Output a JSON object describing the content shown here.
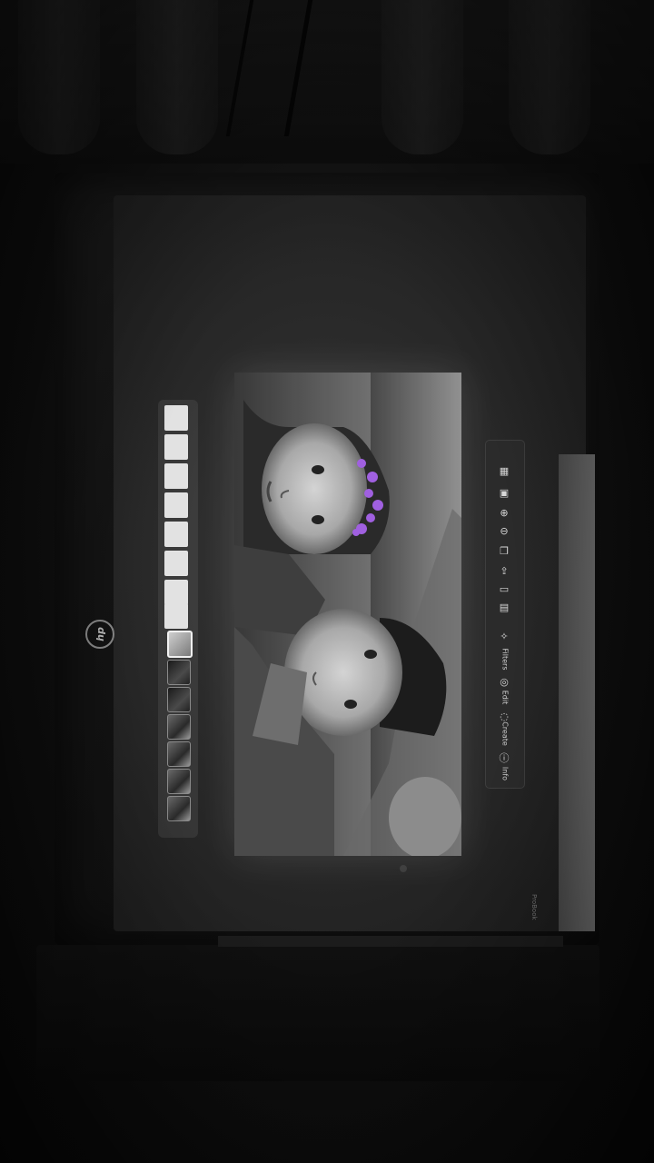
{
  "scene": {
    "subject": "laptop-screen-photo",
    "colors": {
      "tint": "#a060e0",
      "background": "#0b0b0b"
    }
  },
  "laptop": {
    "logo_text": "hp",
    "brand_text": "ProBook"
  },
  "filmstrip": {
    "empty_frames": 8,
    "thumbnails": [
      {
        "name": "thumb-1",
        "selected": true
      },
      {
        "name": "thumb-2",
        "selected": false
      },
      {
        "name": "thumb-3",
        "selected": false
      },
      {
        "name": "thumb-4",
        "selected": false
      },
      {
        "name": "thumb-5",
        "selected": false
      },
      {
        "name": "thumb-6",
        "selected": false
      },
      {
        "name": "thumb-7",
        "selected": false
      }
    ]
  },
  "toolbar": {
    "icons": [
      "grid-icon",
      "image-icon",
      "zoom-in-icon",
      "zoom-out-icon",
      "copy-icon",
      "share-icon",
      "edit-icon",
      "delete-icon"
    ],
    "actions": [
      {
        "icon": "magic-icon",
        "label": "Filters"
      },
      {
        "icon": "crop-icon",
        "label": "Edit"
      },
      {
        "icon": "paint-icon",
        "label": "Create"
      },
      {
        "icon": "info-icon",
        "label": "Info"
      }
    ]
  }
}
